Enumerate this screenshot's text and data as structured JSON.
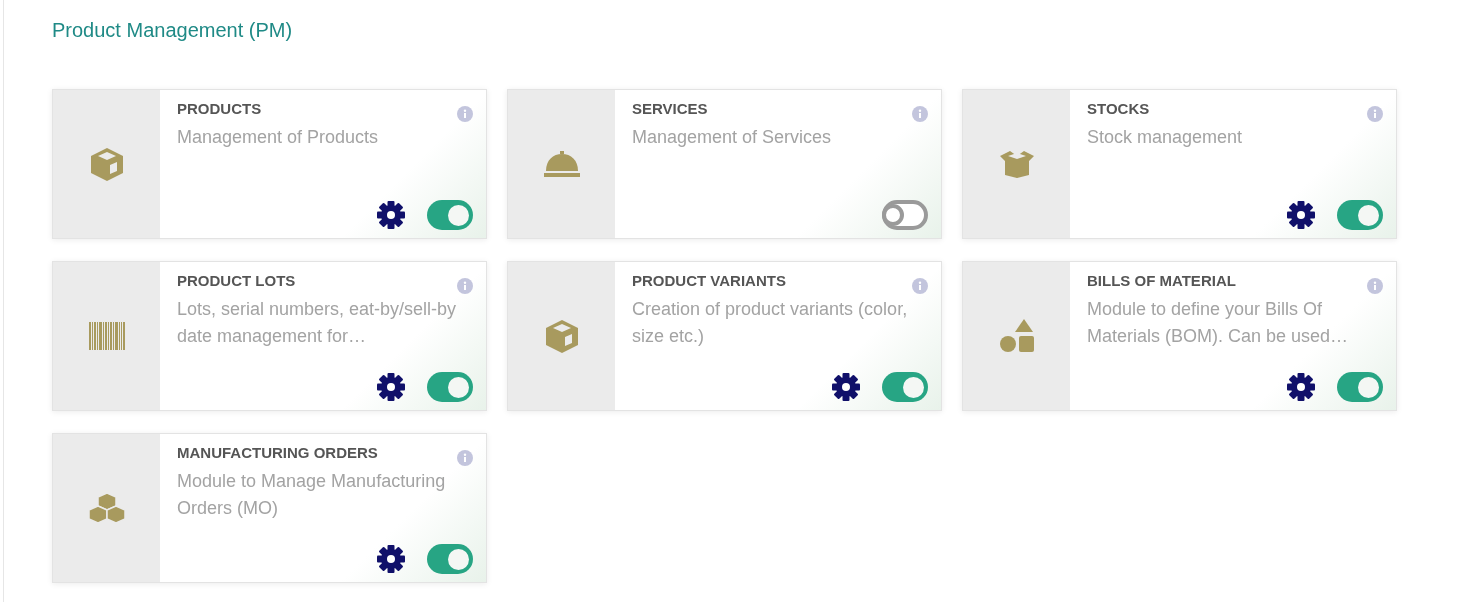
{
  "heading": "Product Management (PM)",
  "modules": [
    {
      "title": "PRODUCTS",
      "description": "Management of Products",
      "enabled": true
    },
    {
      "title": "SERVICES",
      "description": "Management of Services",
      "enabled": false
    },
    {
      "title": "STOCKS",
      "description": "Stock management",
      "enabled": true
    },
    {
      "title": "PRODUCT LOTS",
      "description": "Lots, serial numbers, eat-by/sell-by date management for…",
      "enabled": true
    },
    {
      "title": "PRODUCT VARIANTS",
      "description": "Creation of product variants (color, size etc.)",
      "enabled": true
    },
    {
      "title": "BILLS OF MATERIAL",
      "description": "Module to define your Bills Of Materials (BOM). Can be used…",
      "enabled": true
    },
    {
      "title": "MANUFACTURING ORDERS",
      "description": "Module to Manage Manufacturing Orders (MO)",
      "enabled": true
    }
  ]
}
